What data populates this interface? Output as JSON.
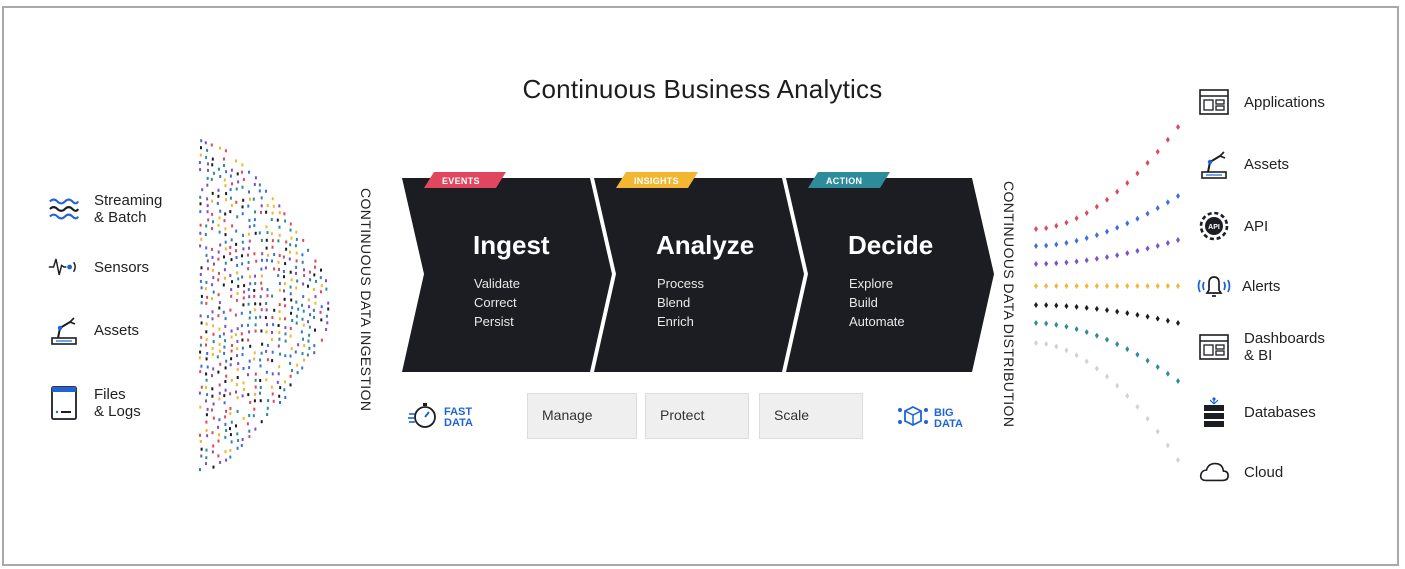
{
  "title": "Continuous Business Analytics",
  "sources": [
    {
      "label_1": "Streaming",
      "label_2": "& Batch",
      "icon": "waves-icon"
    },
    {
      "label_1": "Sensors",
      "label_2": "",
      "icon": "sensor-signal-icon"
    },
    {
      "label_1": "Assets",
      "label_2": "",
      "icon": "robot-arm-icon"
    },
    {
      "label_1": "Files",
      "label_2": "& Logs",
      "icon": "file-window-icon"
    }
  ],
  "ingestion_label": "CONTINUOUS DATA INGESTION",
  "distribution_label": "CONTINUOUS DATA DISTRIBUTION",
  "stages": [
    {
      "tag": "EVENTS",
      "tag_color": "#e0475f",
      "title": "Ingest",
      "items": [
        "Validate",
        "Correct",
        "Persist"
      ]
    },
    {
      "tag": "INSIGHTS",
      "tag_color": "#f2b630",
      "title": "Analyze",
      "items": [
        "Process",
        "Blend",
        "Enrich"
      ]
    },
    {
      "tag": "ACTION",
      "tag_color": "#2e8b9a",
      "title": "Decide",
      "items": [
        "Explore",
        "Build",
        "Automate"
      ]
    }
  ],
  "fast_data": {
    "line_1": "FAST",
    "line_2": "DATA",
    "icon": "stopwatch-icon"
  },
  "big_data": {
    "line_1": "BIG",
    "line_2": "DATA",
    "icon": "cube-network-icon"
  },
  "platform_boxes": [
    "Manage",
    "Protect",
    "Scale"
  ],
  "destinations": [
    {
      "label_1": "Applications",
      "label_2": "",
      "icon": "app-window-icon"
    },
    {
      "label_1": "Assets",
      "label_2": "",
      "icon": "robot-arm-icon"
    },
    {
      "label_1": "API",
      "label_2": "",
      "icon": "api-gear-icon"
    },
    {
      "label_1": "Alerts",
      "label_2": "",
      "icon": "bell-icon"
    },
    {
      "label_1": "Dashboards",
      "label_2": "& BI",
      "icon": "dashboard-window-icon"
    },
    {
      "label_1": "Databases",
      "label_2": "",
      "icon": "database-icon"
    },
    {
      "label_1": "Cloud",
      "label_2": "",
      "icon": "cloud-icon"
    }
  ],
  "colors": {
    "chevron": "#1b1d22",
    "accent_blue": "#1e64d8",
    "dot_red": "#e0475f",
    "dot_blue": "#3b6fe0",
    "dot_purple": "#7a4fd0",
    "dot_yellow": "#f2b630",
    "dot_black": "#1b1d22",
    "dot_teal": "#2e8b9a",
    "dot_gray": "#d2d2d2"
  }
}
